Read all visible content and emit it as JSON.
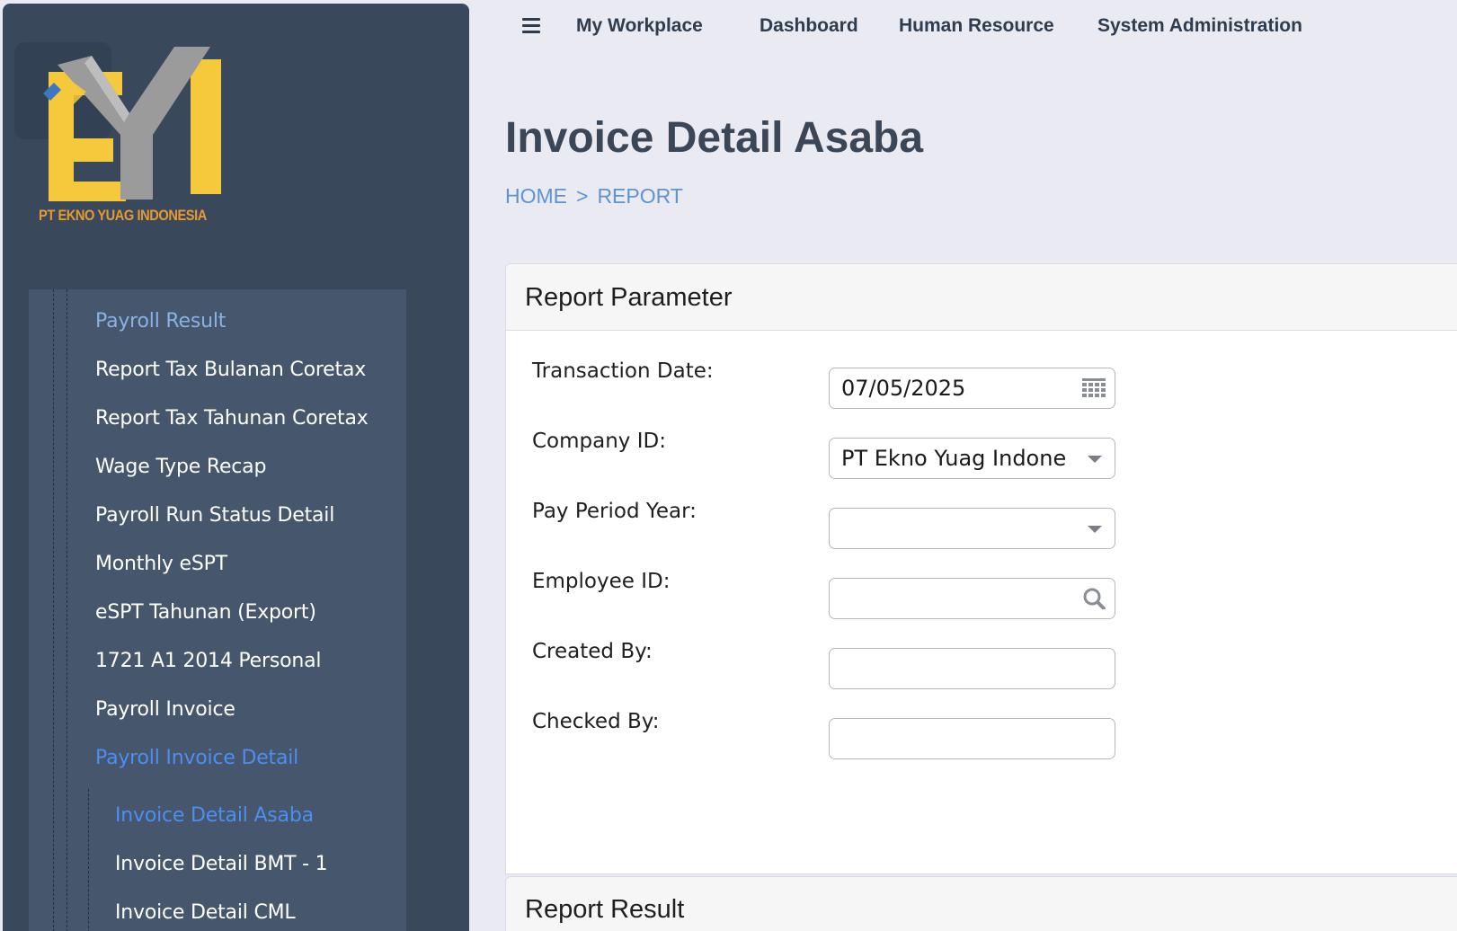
{
  "brand": {
    "logo_text": "PT EKNO YUAG INDONESIA"
  },
  "topnav": {
    "items": [
      "My Workplace",
      "Dashboard",
      "Human Resource",
      "System Administration"
    ]
  },
  "sidebar": {
    "items": [
      {
        "label": "Payroll Result",
        "state": "highlight"
      },
      {
        "label": "Report Tax Bulanan Coretax",
        "state": "normal"
      },
      {
        "label": "Report Tax Tahunan Coretax",
        "state": "normal"
      },
      {
        "label": "Wage Type Recap",
        "state": "normal"
      },
      {
        "label": "Payroll Run Status Detail",
        "state": "normal"
      },
      {
        "label": "Monthly eSPT",
        "state": "normal"
      },
      {
        "label": "eSPT Tahunan (Export)",
        "state": "normal"
      },
      {
        "label": "1721 A1 2014 Personal",
        "state": "normal"
      },
      {
        "label": "Payroll Invoice",
        "state": "normal"
      },
      {
        "label": "Payroll Invoice Detail",
        "state": "active"
      }
    ],
    "subitems": [
      {
        "label": "Invoice Detail Asaba",
        "state": "active"
      },
      {
        "label": "Invoice Detail BMT - 1",
        "state": "normal"
      },
      {
        "label": "Invoice Detail CML",
        "state": "normal"
      }
    ]
  },
  "header": {
    "title": "Invoice Detail Asaba",
    "breadcrumb": {
      "home": "HOME",
      "separator": ">",
      "current": "REPORT"
    }
  },
  "report_parameter": {
    "title": "Report Parameter",
    "fields": {
      "transaction_date": {
        "label": "Transaction Date:",
        "value": "07/05/2025"
      },
      "company_id": {
        "label": "Company ID:",
        "value": "PT Ekno Yuag Indonesia"
      },
      "pay_period_year": {
        "label": "Pay Period Year:",
        "value": ""
      },
      "employee_id": {
        "label": "Employee ID:",
        "value": ""
      },
      "created_by": {
        "label": "Created By:",
        "value": ""
      },
      "checked_by": {
        "label": "Checked By:",
        "value": ""
      }
    }
  },
  "report_result": {
    "title": "Report Result"
  },
  "colors": {
    "sidebar_bg": "#3a485c",
    "menu_panel_bg": "#46566c",
    "highlight": "#89b2e4",
    "active": "#4c8ff0",
    "page_bg": "#e9eaf2",
    "logo_yellow": "#f6c93d",
    "logo_grey": "#9a9a9a"
  },
  "icons": {
    "menu": "hamburger-icon",
    "calendar": "calendar-icon",
    "dropdown": "chevron-down-icon",
    "search": "search-icon"
  }
}
